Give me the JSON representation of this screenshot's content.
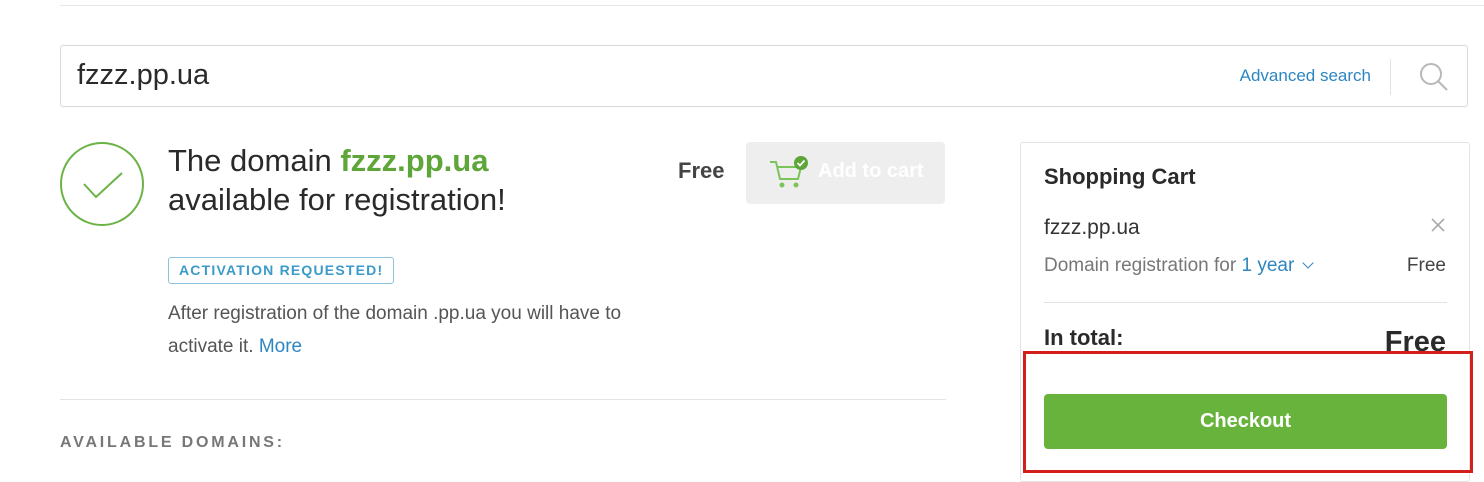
{
  "search": {
    "value": "fzzz.pp.ua",
    "advanced_search_label": "Advanced search",
    "search_icon": "search-icon"
  },
  "result": {
    "title_prefix": "The domain",
    "domain": "fzzz.pp.ua",
    "title_suffix": "available for registration!",
    "price": "Free",
    "add_to_cart_label": "Add to cart",
    "status_icon": "check-circle-icon",
    "cart_icon": "cart-check-icon",
    "badge": "ACTIVATION REQUESTED!",
    "note": "After registration of the domain .pp.ua you will have to activate it.",
    "more_link": "More"
  },
  "available_heading": "AVAILABLE DOMAINS:",
  "cart": {
    "title": "Shopping Cart",
    "item_domain": "fzzz.pp.ua",
    "item_desc": "Domain registration for",
    "item_period": "1 year",
    "item_price": "Free",
    "total_label": "In total:",
    "total_value": "Free",
    "checkout_label": "Checkout"
  },
  "colors": {
    "accent_green": "#67b33b",
    "domain_green": "#5fa63a",
    "link_blue": "#2e86c1",
    "highlight_red": "#d31e1e"
  }
}
